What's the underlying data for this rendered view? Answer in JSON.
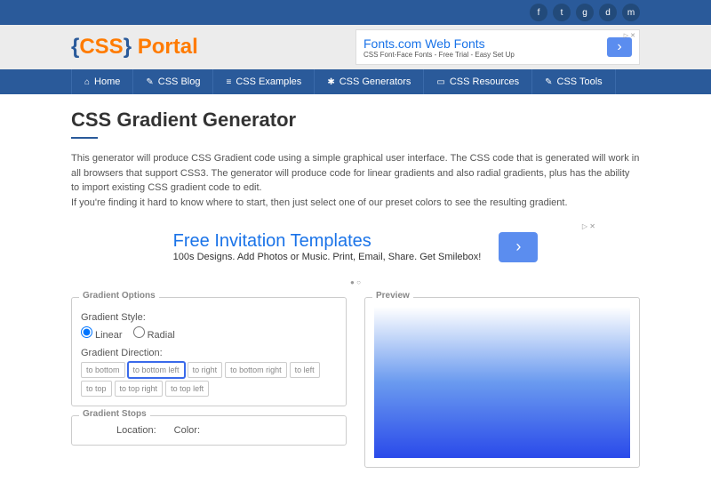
{
  "social": [
    "f",
    "t",
    "g",
    "d",
    "m"
  ],
  "logo": {
    "brace_open": "{",
    "css": "CSS",
    "brace_close": "}",
    "portal": " Portal"
  },
  "ad1": {
    "title": "Fonts.com Web Fonts",
    "sub": "CSS Font-Face Fonts - Free Trial - Easy Set Up",
    "x": "▷ ✕"
  },
  "nav": [
    {
      "icon": "⌂",
      "label": "Home"
    },
    {
      "icon": "✎",
      "label": "CSS Blog"
    },
    {
      "icon": "≡",
      "label": "CSS Examples"
    },
    {
      "icon": "✱",
      "label": "CSS Generators"
    },
    {
      "icon": "▭",
      "label": "CSS Resources"
    },
    {
      "icon": "✎",
      "label": "CSS Tools"
    }
  ],
  "page_title": "CSS Gradient Generator",
  "desc": "This generator will produce CSS Gradient code using a simple graphical user interface. The CSS code that is generated will work in all browsers that support CSS3. The generator will produce code for linear gradients and also radial gradients, plus has the ability to import existing CSS gradient code to edit.\nIf you're finding it hard to know where to start, then just select one of our preset colors to see the resulting gradient.",
  "ad2": {
    "title": "Free Invitation Templates",
    "sub": "100s Designs. Add Photos or Music. Print, Email, Share. Get Smilebox!",
    "x": "▷ ✕"
  },
  "dots": "● ○",
  "panels": {
    "options": "Gradient Options",
    "style_label": "Gradient Style:",
    "linear": "Linear",
    "radial": "Radial",
    "direction_label": "Gradient Direction:",
    "dirs": [
      "to bottom",
      "to bottom left",
      "to right",
      "to bottom right",
      "to left",
      "to top",
      "to top right",
      "to top left"
    ],
    "stops": "Gradient Stops",
    "location": "Location:",
    "color": "Color:",
    "preview": "Preview"
  }
}
